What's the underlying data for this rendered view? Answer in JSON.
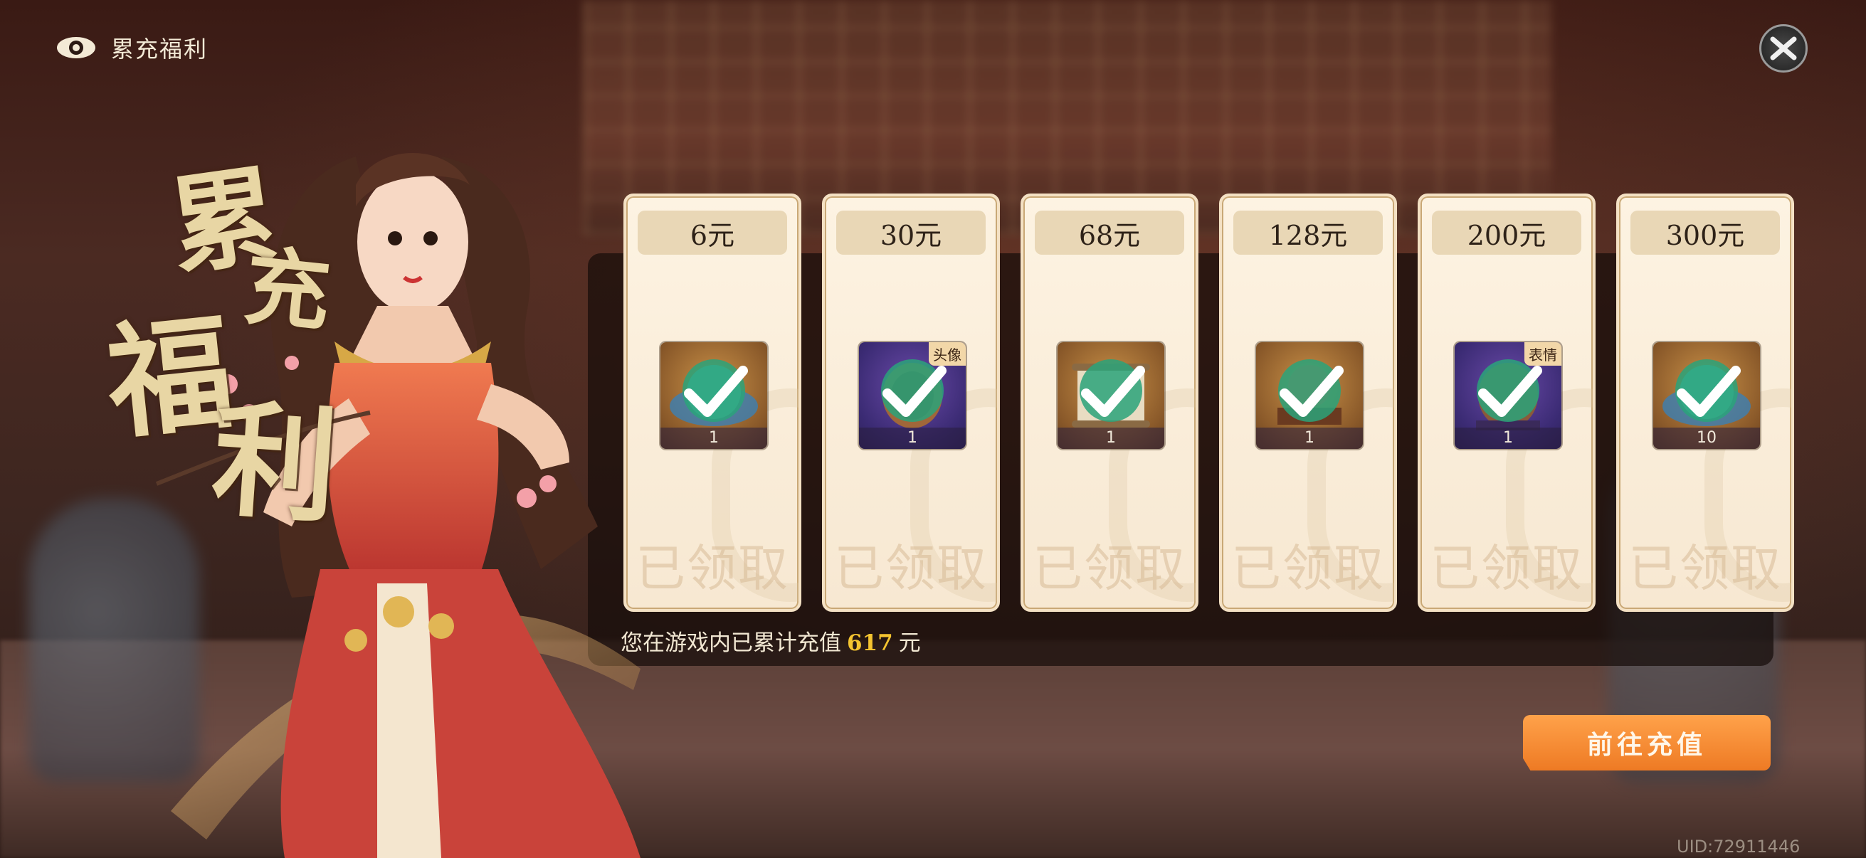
{
  "header": {
    "title": "累充福利"
  },
  "calligraphy": {
    "c1": "累",
    "c2": "充",
    "c3": "福",
    "c4": "利"
  },
  "tiers": [
    {
      "amount": "6元",
      "item": "jade-orb",
      "count": "1",
      "tag": "",
      "status": "已领取"
    },
    {
      "amount": "30元",
      "item": "avatar-frame",
      "count": "1",
      "tag": "头像",
      "status": "已领取"
    },
    {
      "amount": "68元",
      "item": "scroll",
      "count": "1",
      "tag": "",
      "status": "已领取"
    },
    {
      "amount": "128元",
      "item": "pedestal-orb",
      "count": "1",
      "tag": "",
      "status": "已领取"
    },
    {
      "amount": "200元",
      "item": "emote",
      "count": "1",
      "tag": "表情",
      "status": "已领取"
    },
    {
      "amount": "300元",
      "item": "jade-orb",
      "count": "10",
      "tag": "",
      "status": "已领取"
    }
  ],
  "total": {
    "prefix": "您在游戏内已累计充值",
    "amount": "617",
    "suffix": "元"
  },
  "recharge_button": {
    "label": "前往充值"
  },
  "uid": "UID:72911446",
  "colors": {
    "accent": "#ee7a24",
    "gold": "#f4c430",
    "card": "#fdf3e2"
  }
}
